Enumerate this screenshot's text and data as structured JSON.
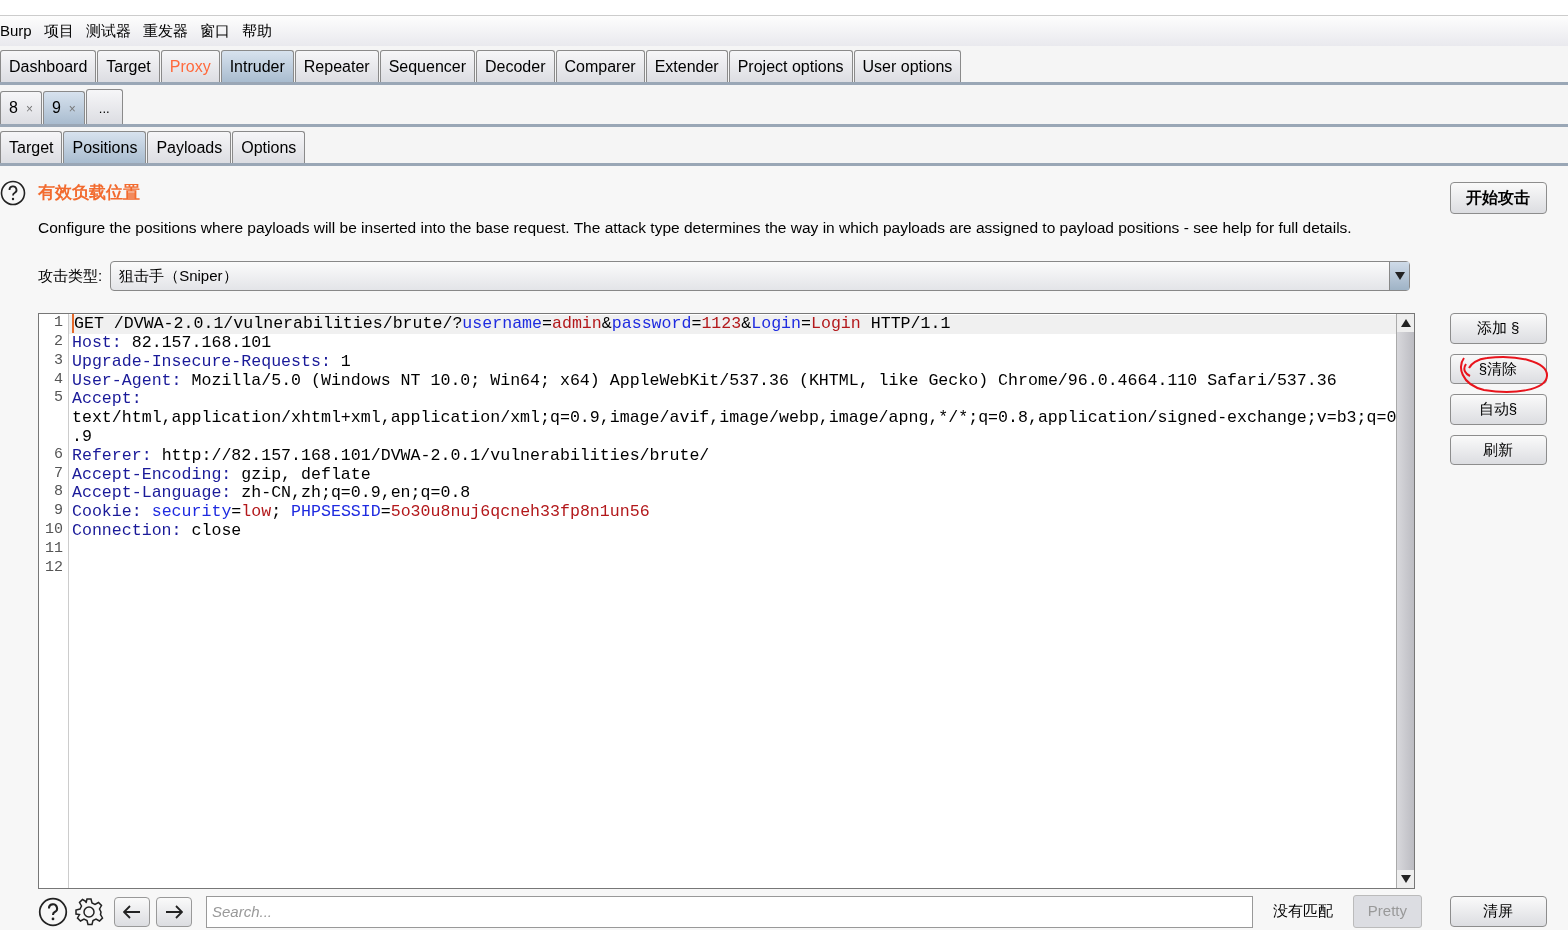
{
  "menu": [
    "Burp",
    "项目",
    "测试器",
    "重发器",
    "窗口",
    "帮助"
  ],
  "main_tabs": [
    {
      "label": "Dashboard",
      "selected": false,
      "highlighted": false
    },
    {
      "label": "Target",
      "selected": false,
      "highlighted": false
    },
    {
      "label": "Proxy",
      "selected": false,
      "highlighted": true
    },
    {
      "label": "Intruder",
      "selected": true,
      "highlighted": false
    },
    {
      "label": "Repeater",
      "selected": false,
      "highlighted": false
    },
    {
      "label": "Sequencer",
      "selected": false,
      "highlighted": false
    },
    {
      "label": "Decoder",
      "selected": false,
      "highlighted": false
    },
    {
      "label": "Comparer",
      "selected": false,
      "highlighted": false
    },
    {
      "label": "Extender",
      "selected": false,
      "highlighted": false
    },
    {
      "label": "Project options",
      "selected": false,
      "highlighted": false
    },
    {
      "label": "User options",
      "selected": false,
      "highlighted": false
    }
  ],
  "attack_tabs": [
    {
      "label": "8",
      "close": "×",
      "selected": false
    },
    {
      "label": "9",
      "close": "×",
      "selected": true
    },
    {
      "label": "...",
      "selected": false
    }
  ],
  "sub_tabs": [
    {
      "label": "Target",
      "selected": false
    },
    {
      "label": "Positions",
      "selected": true
    },
    {
      "label": "Payloads",
      "selected": false
    },
    {
      "label": "Options",
      "selected": false
    }
  ],
  "section": {
    "title": "有效负载位置",
    "description": "Configure the positions where payloads will be inserted into the base request. The attack type determines the way in which payloads are assigned to payload positions - see help for full details.",
    "start_button": "开始攻击"
  },
  "attack_type": {
    "label": "攻击类型:",
    "value": "狙击手（Sniper）"
  },
  "editor": {
    "lines": [
      {
        "number": "1",
        "segments": [
          {
            "text": "GET /DVWA-2.0.1/vulnerabilities/brute/?",
            "kind": "plain"
          },
          {
            "text": "username",
            "kind": "param"
          },
          {
            "text": "=",
            "kind": "plain"
          },
          {
            "text": "admin",
            "kind": "value"
          },
          {
            "text": "&",
            "kind": "plain"
          },
          {
            "text": "password",
            "kind": "param"
          },
          {
            "text": "=",
            "kind": "plain"
          },
          {
            "text": "1123",
            "kind": "value"
          },
          {
            "text": "&",
            "kind": "plain"
          },
          {
            "text": "Login",
            "kind": "param"
          },
          {
            "text": "=",
            "kind": "plain"
          },
          {
            "text": "Login",
            "kind": "value"
          },
          {
            "text": " HTTP/1.1",
            "kind": "plain"
          }
        ]
      },
      {
        "number": "2",
        "segments": [
          {
            "text": "Host:",
            "kind": "header"
          },
          {
            "text": " 82.157.168.101",
            "kind": "plain"
          }
        ]
      },
      {
        "number": "3",
        "segments": [
          {
            "text": "Upgrade-Insecure-Requests:",
            "kind": "header"
          },
          {
            "text": " 1",
            "kind": "plain"
          }
        ]
      },
      {
        "number": "4",
        "segments": [
          {
            "text": "User-Agent:",
            "kind": "header"
          },
          {
            "text": " Mozilla/5.0 (Windows NT 10.0; Win64; x64) AppleWebKit/537.36 (KHTML, like Gecko) Chrome/96.0.4664.110 Safari/537.36",
            "kind": "plain"
          }
        ]
      },
      {
        "number": "5",
        "segments": [
          {
            "text": "Accept:",
            "kind": "header"
          }
        ]
      },
      {
        "segments": [
          {
            "text": "text/html,application/xhtml+xml,application/xml;q=0.9,image/avif,image/webp,image/apng,*/*;q=0.8,application/signed-exchange;v=b3;q=0",
            "kind": "plain"
          }
        ]
      },
      {
        "segments": [
          {
            "text": ".9",
            "kind": "plain"
          }
        ]
      },
      {
        "number": "6",
        "segments": [
          {
            "text": "Referer:",
            "kind": "header"
          },
          {
            "text": " http://82.157.168.101/DVWA-2.0.1/vulnerabilities/brute/",
            "kind": "plain"
          }
        ]
      },
      {
        "number": "7",
        "segments": [
          {
            "text": "Accept-Encoding:",
            "kind": "header"
          },
          {
            "text": " gzip, deflate",
            "kind": "plain"
          }
        ]
      },
      {
        "number": "8",
        "segments": [
          {
            "text": "Accept-Language:",
            "kind": "header"
          },
          {
            "text": " zh-CN,zh;q=0.9,en;q=0.8",
            "kind": "plain"
          }
        ]
      },
      {
        "number": "9",
        "segments": [
          {
            "text": "Cookie:",
            "kind": "header"
          },
          {
            "text": " security",
            "kind": "param"
          },
          {
            "text": "=",
            "kind": "plain"
          },
          {
            "text": "low",
            "kind": "value"
          },
          {
            "text": "; ",
            "kind": "plain"
          },
          {
            "text": "PHPSESSID",
            "kind": "param"
          },
          {
            "text": "=",
            "kind": "plain"
          },
          {
            "text": "5o30u8nuj6qcneh33fp8n1un56",
            "kind": "value"
          }
        ]
      },
      {
        "number": "10",
        "segments": [
          {
            "text": "Connection:",
            "kind": "header"
          },
          {
            "text": " close",
            "kind": "plain"
          }
        ]
      },
      {
        "number": "11"
      },
      {
        "number": "12"
      }
    ]
  },
  "side_buttons": [
    {
      "label": "添加 §",
      "circled": false
    },
    {
      "label": "§清除",
      "circled": true
    },
    {
      "label": "自动§",
      "circled": false
    },
    {
      "label": "刷新",
      "circled": false
    }
  ],
  "footer": {
    "search_placeholder": "Search...",
    "match_status": "没有匹配",
    "pretty_button": {
      "label": "Pretty",
      "disabled": true
    },
    "clear_button": "清屏"
  }
}
